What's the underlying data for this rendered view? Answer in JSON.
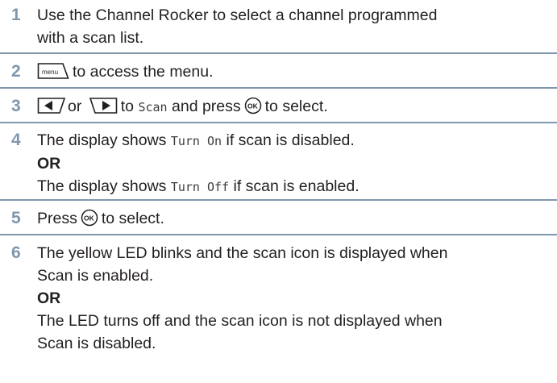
{
  "steps": [
    {
      "num": "1",
      "line1": "Use the Channel Rocker to select a channel programmed",
      "line2": "with a scan list."
    },
    {
      "num": "2",
      "key_label": "menu",
      "text": "to access the menu."
    },
    {
      "num": "3",
      "or_text": "or",
      "to_text": "to",
      "scan_word": "Scan",
      "and_text": "and press",
      "select_text": "to select."
    },
    {
      "num": "4",
      "prefix": "The display shows",
      "turn_on": "Turn On",
      "disabled_suffix": "if scan is disabled.",
      "or_label": "OR",
      "turn_off": "Turn Off",
      "enabled_suffix": "if scan is enabled."
    },
    {
      "num": "5",
      "press": "Press",
      "select_text": "to select."
    },
    {
      "num": "6",
      "line1": "The yellow LED blinks and the scan icon is displayed when",
      "line2": "Scan is enabled.",
      "or_label": "OR",
      "line3": "The LED turns off and the scan icon is not displayed when",
      "line4": "Scan is disabled."
    }
  ],
  "icons": {
    "menu_key": "menu-key-icon",
    "left_key": "left-arrow-key-icon",
    "right_key": "right-arrow-key-icon",
    "ok_button": "ok-button-icon"
  },
  "colors": {
    "step_number": "#7f97ad",
    "divider": "#7f97ad",
    "text": "#231f20"
  }
}
